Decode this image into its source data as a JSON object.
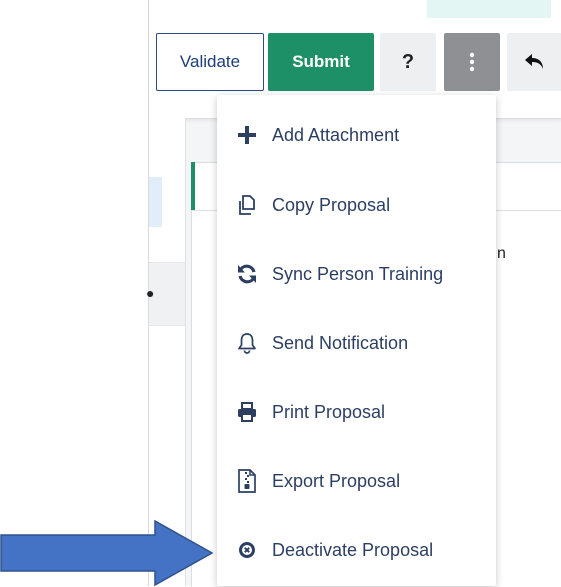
{
  "toolbar": {
    "validate_label": "Validate",
    "submit_label": "Submit",
    "help_label": "?",
    "more_icon": "vertical-ellipsis-icon",
    "back_icon": "undo-arrow-icon"
  },
  "background": {
    "fragment_text": "n",
    "left_icon_text": "●"
  },
  "menu": {
    "items": [
      {
        "label": "Add Attachment",
        "icon": "plus-icon"
      },
      {
        "label": "Copy Proposal",
        "icon": "copy-icon"
      },
      {
        "label": "Sync Person Training",
        "icon": "sync-icon"
      },
      {
        "label": "Send Notification",
        "icon": "bell-icon"
      },
      {
        "label": "Print Proposal",
        "icon": "printer-icon"
      },
      {
        "label": "Export Proposal",
        "icon": "file-zip-icon"
      },
      {
        "label": "Deactivate Proposal",
        "icon": "circle-x-icon"
      }
    ]
  },
  "colors": {
    "submit_green": "#1e9068",
    "validate_border": "#2d4a86",
    "menu_text": "#2c3f63",
    "arrow_fill": "#4472c4",
    "arrow_stroke": "#2f528f"
  }
}
